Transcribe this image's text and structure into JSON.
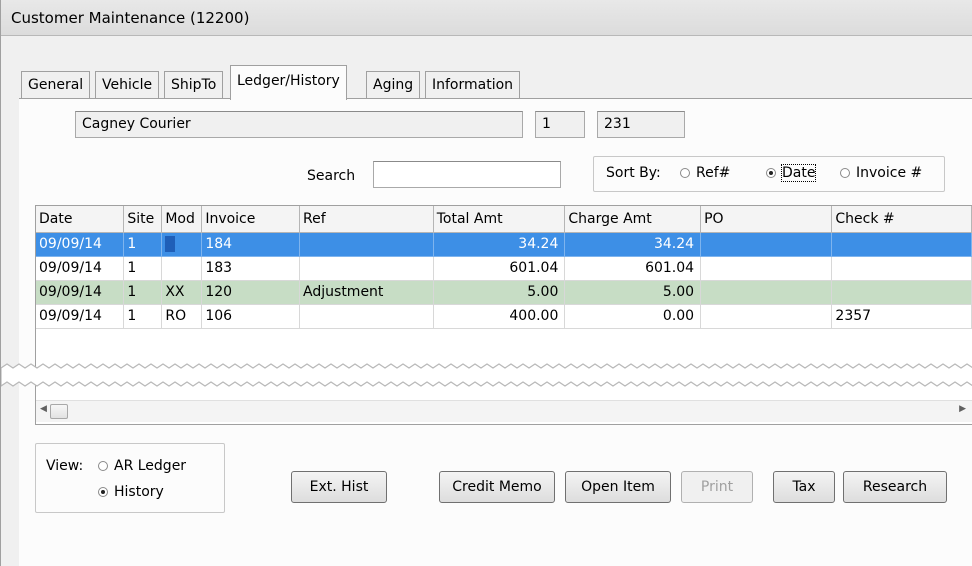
{
  "window": {
    "title": "Customer Maintenance (12200)"
  },
  "tabs": [
    {
      "label": "General",
      "active": false
    },
    {
      "label": "Vehicle",
      "active": false
    },
    {
      "label": "ShipTo",
      "active": false
    },
    {
      "label": "Ledger/History",
      "active": true
    },
    {
      "label": "Aging",
      "active": false
    },
    {
      "label": "Information",
      "active": false
    }
  ],
  "customer": {
    "name": "Cagney Courier",
    "site": "1",
    "number": "231"
  },
  "search": {
    "label": "Search",
    "value": ""
  },
  "sort": {
    "label": "Sort By:",
    "options": [
      {
        "label": "Ref#",
        "selected": false
      },
      {
        "label": "Date",
        "selected": true
      },
      {
        "label": "Invoice #",
        "selected": false
      }
    ]
  },
  "grid": {
    "columns": [
      "Date",
      "Site",
      "Mod",
      "Invoice",
      "Ref",
      "Total Amt",
      "Charge Amt",
      "PO",
      "Check #"
    ],
    "rows": [
      {
        "date": "09/09/14",
        "site": "1",
        "mod": "",
        "invoice": "184",
        "ref": "",
        "total_amt": "34.24",
        "charge_amt": "34.24",
        "po": "",
        "check": "",
        "state": "selected"
      },
      {
        "date": "09/09/14",
        "site": "1",
        "mod": "",
        "invoice": "183",
        "ref": "",
        "total_amt": "601.04",
        "charge_amt": "601.04",
        "po": "",
        "check": "",
        "state": "normal"
      },
      {
        "date": "09/09/14",
        "site": "1",
        "mod": "XX",
        "invoice": "120",
        "ref": "Adjustment",
        "total_amt": "5.00",
        "charge_amt": "5.00",
        "po": "",
        "check": "",
        "state": "highlight"
      },
      {
        "date": "09/09/14",
        "site": "1",
        "mod": "RO",
        "invoice": "106",
        "ref": "",
        "total_amt": "400.00",
        "charge_amt": "0.00",
        "po": "",
        "check": "2357",
        "state": "normal"
      }
    ]
  },
  "view": {
    "label": "View:",
    "options": [
      {
        "label": "AR Ledger",
        "selected": false
      },
      {
        "label": "History",
        "selected": true
      }
    ]
  },
  "buttons": {
    "ext_hist": "Ext. Hist",
    "credit_memo": "Credit Memo",
    "open_item": "Open Item",
    "print": "Print",
    "tax": "Tax",
    "research": "Research"
  },
  "colors": {
    "selection": "#3d8fe6",
    "highlight_row": "#c7ddc5"
  }
}
